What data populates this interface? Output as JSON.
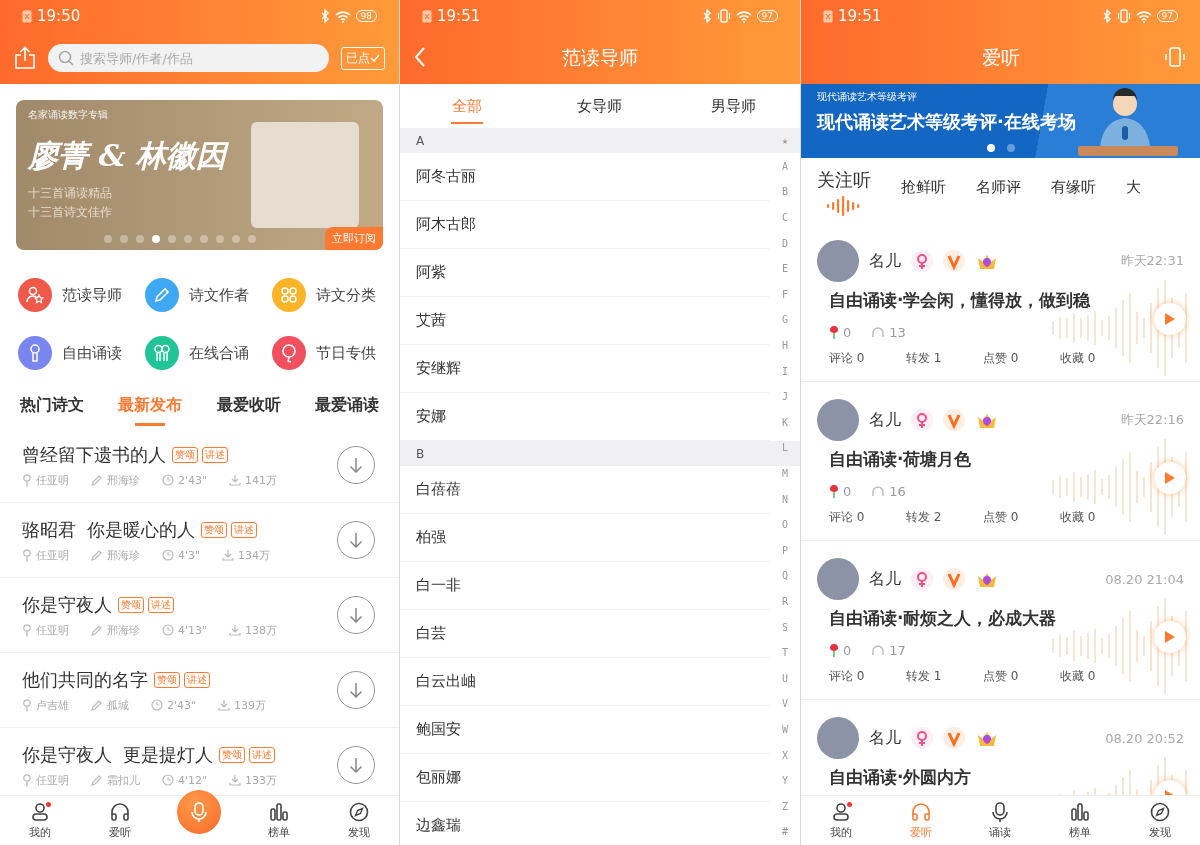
{
  "home_screen": {
    "status_bar": {
      "time": "19:50",
      "battery": "98",
      "vibrate": false
    },
    "search": {
      "placeholder": "搜索导师/作者/作品"
    },
    "played_button": {
      "label": "已点"
    },
    "banner": {
      "caption": "名家诵读数字专辑",
      "title": "廖菁 & 林徽因",
      "lines": [
        "十三首诵读精品",
        "十三首诗文佳作"
      ],
      "action": "立即订阅",
      "dots": [
        {
          "selected": false
        },
        {
          "selected": false
        },
        {
          "selected": false
        },
        {
          "selected": true
        },
        {
          "selected": false
        },
        {
          "selected": false
        },
        {
          "selected": false
        },
        {
          "selected": false
        },
        {
          "selected": false
        },
        {
          "selected": false
        }
      ]
    },
    "categories": [
      {
        "label": "范读导师",
        "color": "#f0584a"
      },
      {
        "label": "诗文作者",
        "color": "#3ea8f2"
      },
      {
        "label": "诗文分类",
        "color": "#fbb327"
      },
      {
        "label": "自由诵读",
        "color": "#7a86f0"
      },
      {
        "label": "在线合诵",
        "color": "#20c497"
      },
      {
        "label": "节日专供",
        "color": "#f2505e"
      }
    ],
    "tabs": [
      {
        "label": "热门诗文",
        "selected": false
      },
      {
        "label": "最新发布",
        "selected": true
      },
      {
        "label": "最爱收听",
        "selected": false
      },
      {
        "label": "最爱诵读",
        "selected": false
      }
    ],
    "works": [
      {
        "title": "曾经留下遗书的人",
        "tags": [
          "赞颂",
          "讲述"
        ],
        "reader": "任亚明",
        "author": "邢海珍",
        "duration": "2'43\"",
        "downloads": "141万"
      },
      {
        "title": "骆昭君  你是暖心的人",
        "tags": [
          "赞颂",
          "讲述"
        ],
        "reader": "任亚明",
        "author": "邢海珍",
        "duration": "4'3\"",
        "downloads": "134万"
      },
      {
        "title": "你是守夜人",
        "tags": [
          "赞颂",
          "讲述"
        ],
        "reader": "任亚明",
        "author": "邢海珍",
        "duration": "4'13\"",
        "downloads": "138万"
      },
      {
        "title": "他们共同的名字",
        "tags": [
          "赞颂",
          "讲述"
        ],
        "reader": "卢吉雄",
        "author": "孤城",
        "duration": "2'43\"",
        "downloads": "139万"
      },
      {
        "title": "你是守夜人  更是提灯人",
        "tags": [
          "赞颂",
          "讲述"
        ],
        "reader": "任亚明",
        "author": "霜扣儿",
        "duration": "4'12\"",
        "downloads": "133万"
      }
    ],
    "bottom_nav": [
      {
        "kind": "tab",
        "label": "我的",
        "selected": false,
        "dot": true
      },
      {
        "kind": "tab",
        "label": "爱听",
        "selected": false,
        "dot": false
      },
      {
        "kind": "record",
        "selected": true
      },
      {
        "kind": "tab",
        "label": "榜单",
        "selected": false,
        "dot": false
      },
      {
        "kind": "tab",
        "label": "发现",
        "selected": false,
        "dot": false
      }
    ]
  },
  "teachers_screen": {
    "status_bar": {
      "time": "19:51",
      "battery": "97",
      "vibrate": true
    },
    "title": "范读导师",
    "tabs": [
      {
        "label": "全部",
        "selected": true
      },
      {
        "label": "女导师",
        "selected": false
      },
      {
        "label": "男导师",
        "selected": false
      }
    ],
    "sections": [
      {
        "letter": "A",
        "names": [
          "阿冬古丽",
          "阿木古郎",
          "阿紫",
          "艾茜",
          "安继辉",
          "安娜"
        ]
      },
      {
        "letter": "B",
        "names": [
          "白蓓蓓",
          "柏强",
          "白一非",
          "白芸",
          "白云出岫",
          "鲍国安",
          "包丽娜",
          "边鑫瑞"
        ]
      }
    ],
    "index": [
      "★",
      "A",
      "B",
      "C",
      "D",
      "E",
      "F",
      "G",
      "H",
      "I",
      "J",
      "K",
      "L",
      "M",
      "N",
      "O",
      "P",
      "Q",
      "R",
      "S",
      "T",
      "U",
      "V",
      "W",
      "X",
      "Y",
      "Z",
      "#"
    ]
  },
  "listen_screen": {
    "status_bar": {
      "time": "19:51",
      "battery": "97",
      "vibrate": true
    },
    "title": "爱听",
    "banner": {
      "caption": "现代诵读艺术等级考评",
      "headline": "现代诵读艺术等级考评·在线考场",
      "dots": [
        {
          "selected": true
        },
        {
          "selected": false
        }
      ]
    },
    "tabs": [
      {
        "label": "关注听",
        "selected": true
      },
      {
        "label": "抢鲜听",
        "selected": false
      },
      {
        "label": "名师评",
        "selected": false
      },
      {
        "label": "有缘听",
        "selected": false
      },
      {
        "label": "大",
        "selected": false
      }
    ],
    "posts": [
      {
        "name": "名儿",
        "time": "昨天22:31",
        "title": "自由诵读·学会闲，懂得放，做到稳",
        "flowers": "0",
        "plays": "13",
        "actions": [
          "评论 0",
          "转发 1",
          "点赞 0",
          "收藏 0"
        ]
      },
      {
        "name": "名儿",
        "time": "昨天22:16",
        "title": "自由诵读·荷塘月色",
        "flowers": "0",
        "plays": "16",
        "actions": [
          "评论 0",
          "转发 2",
          "点赞 0",
          "收藏 0"
        ]
      },
      {
        "name": "名儿",
        "time": "08.20 21:04",
        "title": "自由诵读·耐烦之人，必成大器",
        "flowers": "0",
        "plays": "17",
        "actions": [
          "评论 0",
          "转发 1",
          "点赞 0",
          "收藏 0"
        ]
      },
      {
        "name": "名儿",
        "time": "08.20 20:52",
        "title": "自由诵读·外圆内方"
      }
    ],
    "bottom_nav": [
      {
        "kind": "tab",
        "label": "我的",
        "selected": false,
        "dot": true
      },
      {
        "kind": "tab",
        "label": "爱听",
        "selected": true,
        "dot": false
      },
      {
        "kind": "tab",
        "label": "诵读",
        "selected": false,
        "dot": false
      },
      {
        "kind": "tab",
        "label": "榜单",
        "selected": false,
        "dot": false
      },
      {
        "kind": "tab",
        "label": "发现",
        "selected": false,
        "dot": false
      }
    ]
  }
}
